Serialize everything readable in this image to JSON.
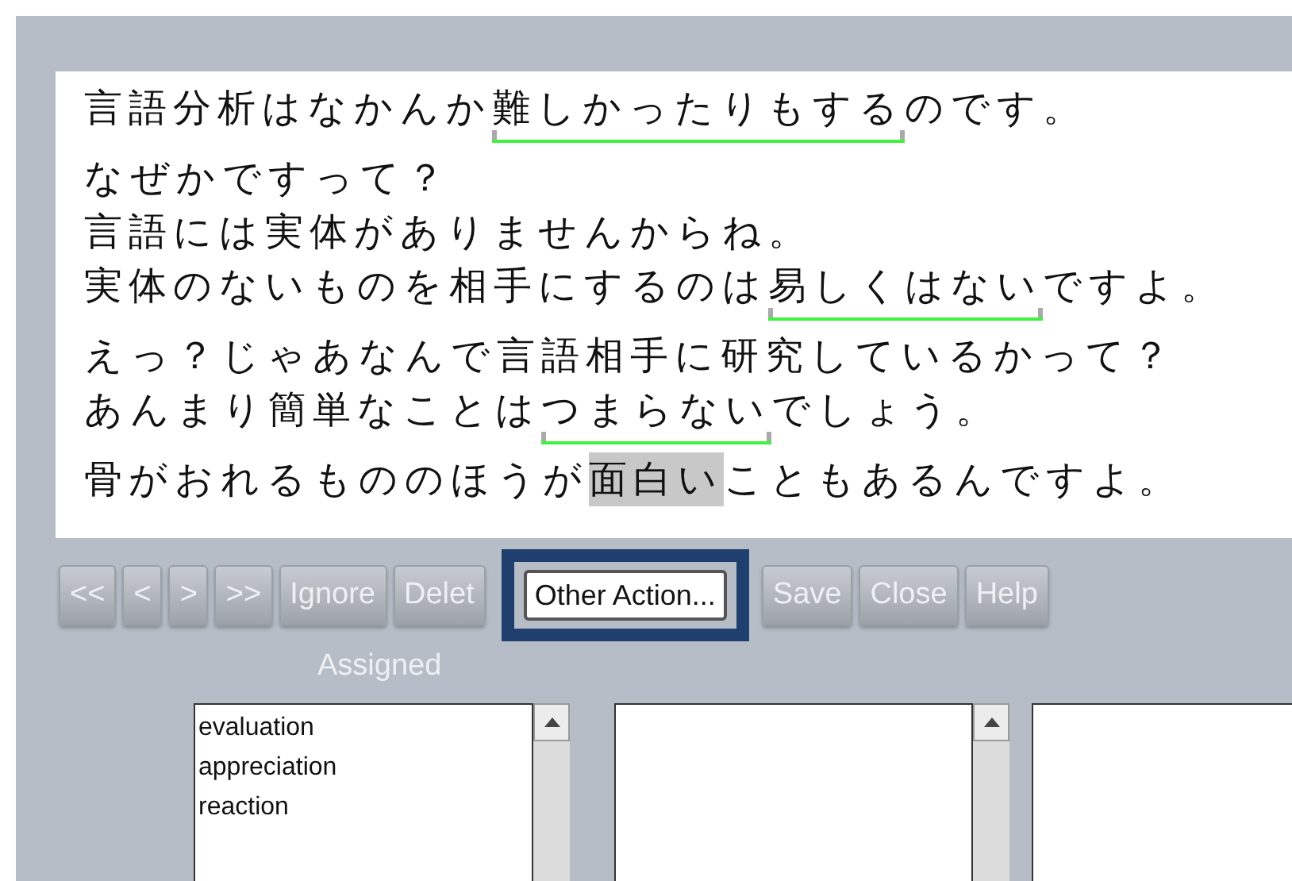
{
  "text_lines": [
    {
      "segments": [
        {
          "text": "言語分析はなかんか",
          "kind": "plain"
        },
        {
          "text": "難しかったりもする",
          "kind": "underline"
        },
        {
          "text": "のです。",
          "kind": "plain"
        }
      ]
    },
    {
      "segments": [
        {
          "text": "なぜかですって？",
          "kind": "plain"
        }
      ]
    },
    {
      "segments": [
        {
          "text": "言語には実体がありませんからね。",
          "kind": "plain"
        }
      ]
    },
    {
      "segments": [
        {
          "text": "実体のないものを相手にするのは",
          "kind": "plain"
        },
        {
          "text": "易しくはない",
          "kind": "underline"
        },
        {
          "text": "ですよ。",
          "kind": "plain"
        }
      ]
    },
    {
      "segments": [
        {
          "text": "えっ？じゃあなんで言語相手に研究しているかって？",
          "kind": "plain"
        }
      ]
    },
    {
      "segments": [
        {
          "text": "あんまり簡単なことは",
          "kind": "plain"
        },
        {
          "text": "つまらない",
          "kind": "underline"
        },
        {
          "text": "でしょう。",
          "kind": "plain"
        }
      ]
    },
    {
      "segments": [
        {
          "text": "骨がおれるもののほうが",
          "kind": "plain"
        },
        {
          "text": "面白い",
          "kind": "highlight"
        },
        {
          "text": "こともあるんですよ。",
          "kind": "plain"
        }
      ]
    }
  ],
  "buttons": [
    {
      "label": "<<",
      "disabled": true,
      "highlighted": false
    },
    {
      "label": "<",
      "disabled": true,
      "highlighted": false
    },
    {
      "label": ">",
      "disabled": true,
      "highlighted": false
    },
    {
      "label": ">>",
      "disabled": true,
      "highlighted": false
    },
    {
      "label": "Ignore",
      "disabled": true,
      "highlighted": false
    },
    {
      "label": "Delet",
      "disabled": true,
      "highlighted": false
    },
    {
      "label": "Other Action...",
      "disabled": false,
      "highlighted": true
    },
    {
      "label": "Save",
      "disabled": true,
      "highlighted": false
    },
    {
      "label": "Close",
      "disabled": true,
      "highlighted": false
    },
    {
      "label": "Help",
      "disabled": true,
      "highlighted": false
    }
  ],
  "assigned_label": "Assigned",
  "lists": [
    {
      "kind": "scroll",
      "items": [
        "evaluation",
        "appreciation",
        "reaction"
      ]
    },
    {
      "kind": "scroll"
    },
    {
      "kind": "plain"
    }
  ]
}
